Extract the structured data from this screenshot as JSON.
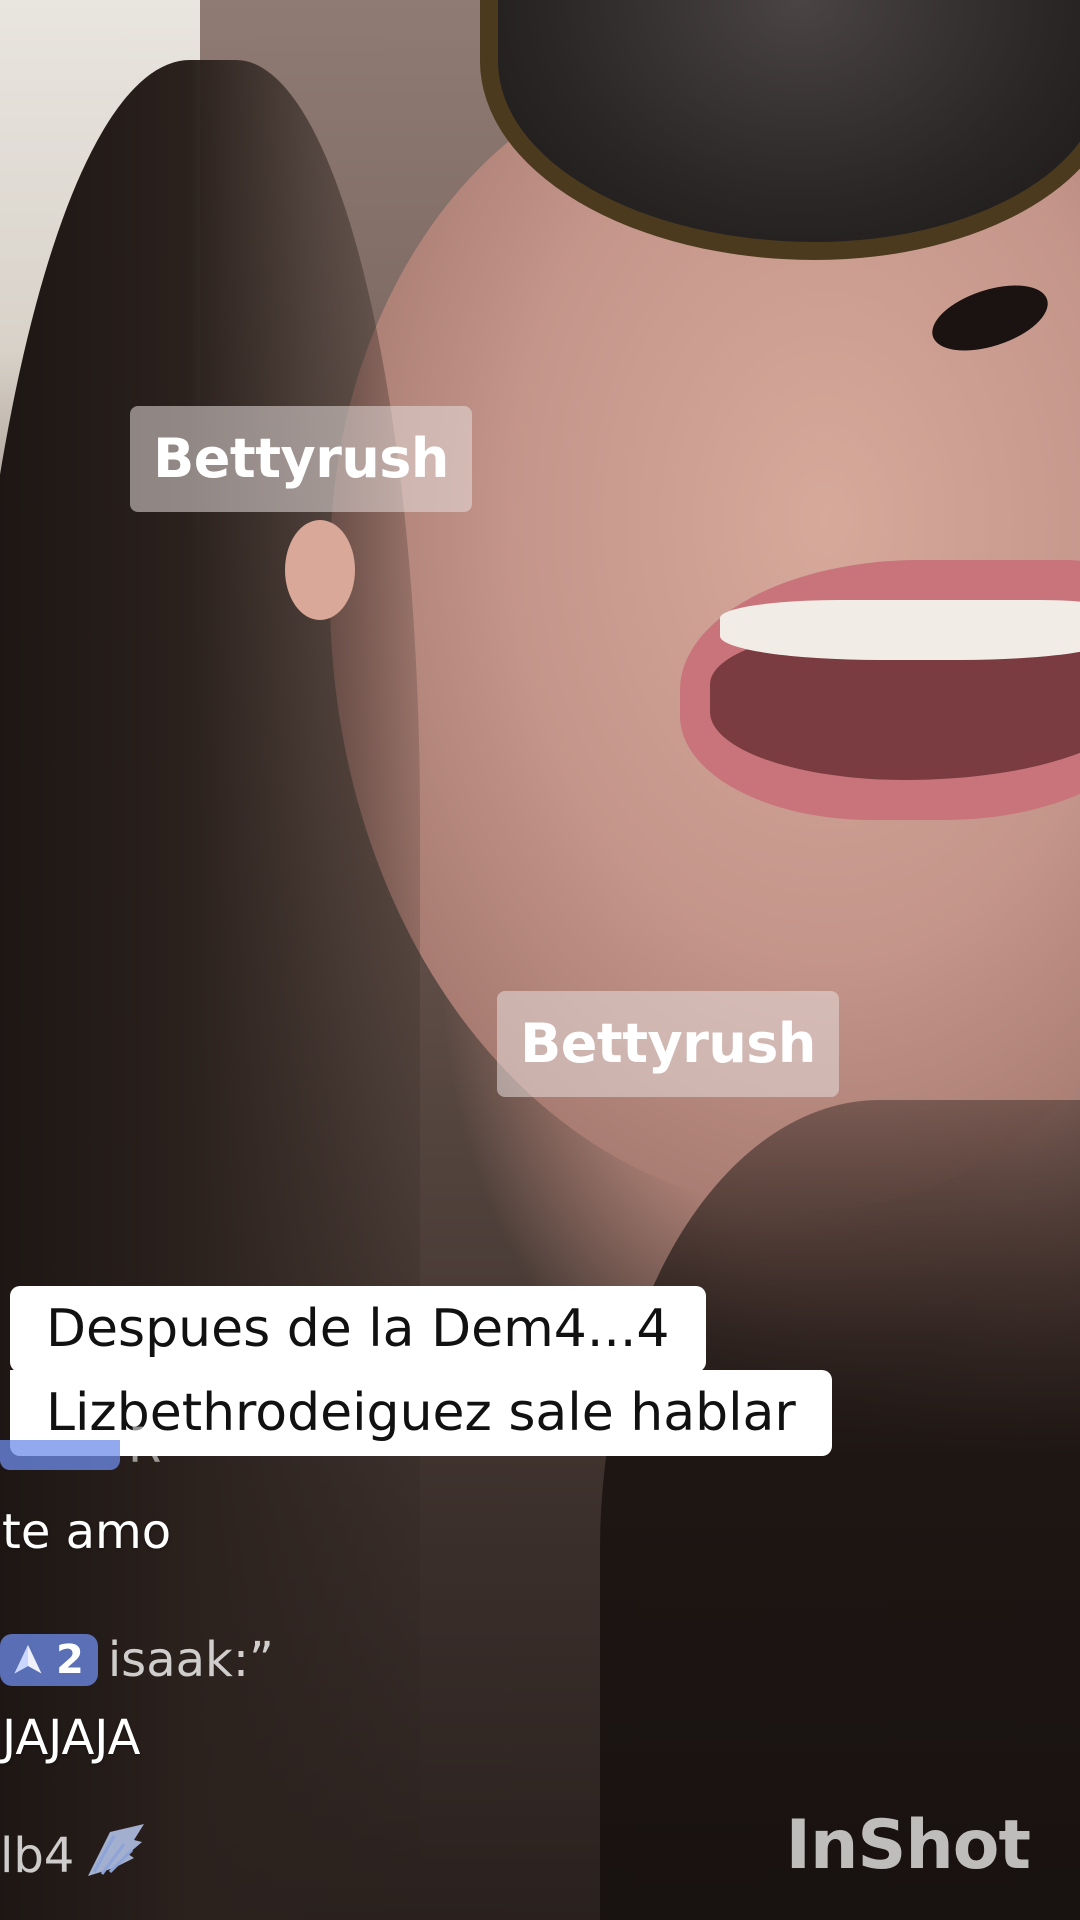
{
  "name_tags": [
    "Bettyrush",
    "Bettyrush"
  ],
  "caption": {
    "line1": "Despues de la Dem4...4",
    "line2": "Lizbethrodeiguez sale hablar"
  },
  "chat": [
    {
      "badge_level": "",
      "username": "R",
      "message": "te amo"
    },
    {
      "badge_level": "2",
      "username": "isaak:”",
      "message": "JAJAJA"
    },
    {
      "badge_level": "",
      "username": "lb4",
      "message": ""
    }
  ],
  "watermark": "InShot",
  "icons": {
    "badge_icon": "navigation-arrow-icon",
    "wing_icon": "wing-icon"
  },
  "colors": {
    "badge": "#6E8CEB",
    "caption_bg": "#FFFFFF",
    "caption_text": "#111111"
  }
}
